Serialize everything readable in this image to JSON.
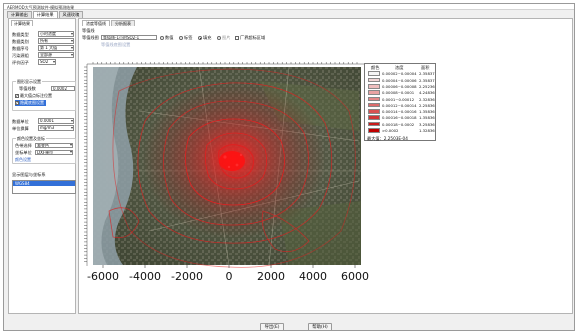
{
  "window": {
    "title": "AERMOD大气预测软件-模拟预测结果"
  },
  "main_tabs": [
    {
      "label": "计算输出"
    },
    {
      "label": "计算结果"
    },
    {
      "label": "风速玫瑰"
    }
  ],
  "left": {
    "subtab": "计算结果",
    "rows": [
      {
        "label": "数据类型",
        "value": "小时浓度"
      },
      {
        "label": "数据类别",
        "value": "所有"
      },
      {
        "label": "数据序号",
        "value": "第 1 大值"
      },
      {
        "label": "污染源组",
        "value": "全部源"
      },
      {
        "label": "评价因子",
        "value": "SO2"
      }
    ],
    "contour_group": "图形显示设置",
    "contour_count_label": "等值线数",
    "contour_count_value": "0.0002",
    "check_display": "最大值点标注位置",
    "check_hide": "隐藏底图设置",
    "unit_rows": [
      {
        "label": "数据单位",
        "value": "0.0001"
      },
      {
        "label": "单位换算",
        "value": "mg/m3"
      }
    ],
    "color_group": "颜色设置及坐标",
    "color_rows": [
      {
        "label": "色带选择",
        "value": "渐变色"
      },
      {
        "label": "坐标单位",
        "value": "DXF单位"
      }
    ],
    "link": "颜色设置",
    "list_title": "显示图层与坐标系",
    "list_item": "WGS84"
  },
  "right": {
    "tabs": [
      {
        "label": "浓度等值线"
      },
      {
        "label": "分析报表"
      }
    ],
    "group": "等值线",
    "filename_label": "等值线图",
    "filename_value": "等值线-1小时SO2-1",
    "radio1": "数值",
    "radio2": "标签",
    "radio3": "填充",
    "radio4": "图片",
    "check_boundary": "厂界超标区域",
    "sublink": "等值线底图设置"
  },
  "legend": {
    "col_color": "颜色",
    "col_range": "浓度",
    "col_area": "面积",
    "rows": [
      {
        "range": "0.00002~0.00004",
        "area": "2.35837"
      },
      {
        "range": "0.00004~0.00006",
        "area": "2.35837"
      },
      {
        "range": "0.00006~0.00008",
        "area": "2.25236"
      },
      {
        "range": "0.00008~0.0001",
        "area": "4.24836"
      },
      {
        "range": "0.0001~0.00012",
        "area": "2.32836"
      },
      {
        "range": "0.00012~0.00014",
        "area": "2.25836"
      },
      {
        "range": "0.00014~0.00016",
        "area": "1.35836"
      },
      {
        "range": "0.00016~0.00018",
        "area": "1.35836"
      },
      {
        "range": "0.00018~0.0002",
        "area": "3.25836"
      },
      {
        "range": ">0.0002",
        "area": "1.32836"
      }
    ],
    "max": "最大值：2.2503E-04"
  },
  "colors": {
    "swatches": [
      "#f5f5f5",
      "#f2d6d6",
      "#eebdbd",
      "#e9a3a3",
      "#e48888",
      "#de6d6d",
      "#d85151",
      "#d13535",
      "#c91c1c",
      "#c00000"
    ]
  },
  "x_axis": {
    "ticks": [
      "-6000",
      "-4000",
      "-2000",
      "0",
      "2000",
      "4000",
      "6000"
    ]
  },
  "buttons": {
    "export": "导出(E)",
    "help": "帮助(H)"
  }
}
